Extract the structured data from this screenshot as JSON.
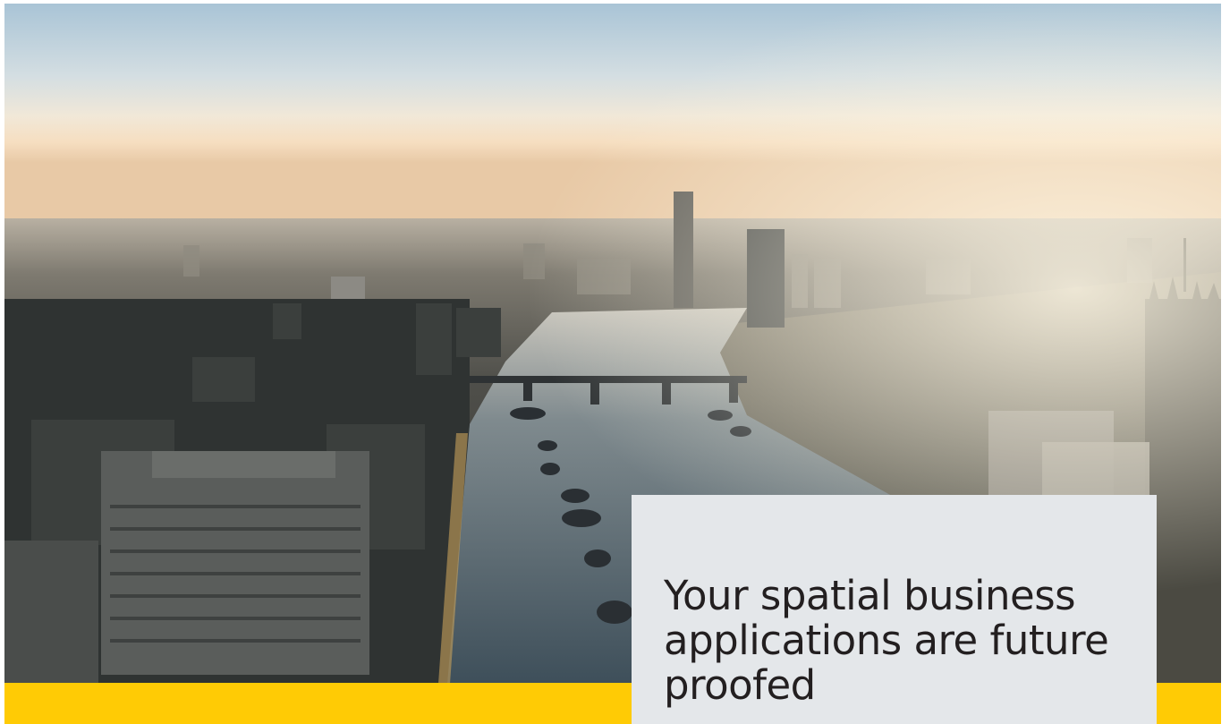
{
  "hero": {
    "headline": "Your spatial business applications are future proofed"
  },
  "colors": {
    "accent_band": "#ffcb05",
    "card_background": "#e4e7ea",
    "headline_text": "#231f20"
  },
  "icons": {
    "hero_image": "city-river-skyline-image"
  }
}
